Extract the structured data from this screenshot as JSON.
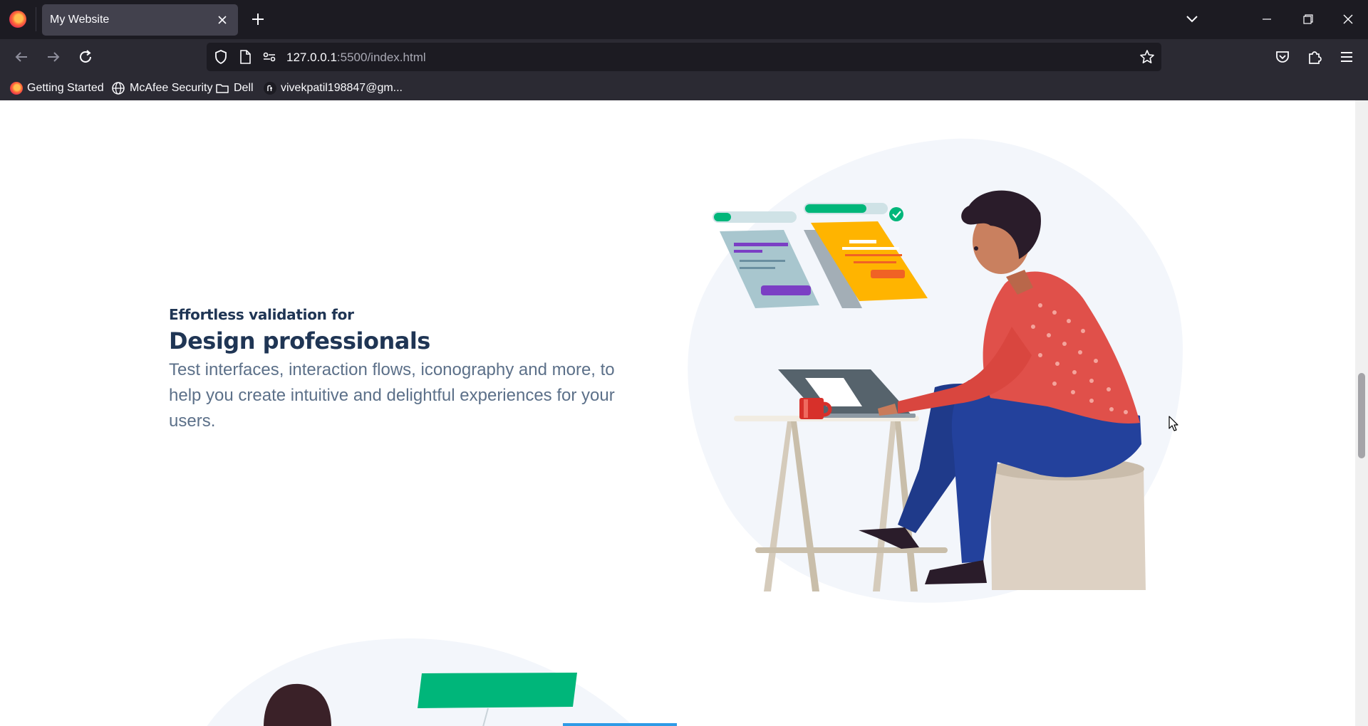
{
  "browser": {
    "tab": {
      "title": "My Website"
    },
    "url": {
      "host": "127.0.0.1",
      "rest": ":5500/index.html"
    },
    "bookmarks": [
      {
        "label": "Getting Started"
      },
      {
        "label": "McAfee Security"
      },
      {
        "label": "Dell"
      },
      {
        "label": "vivekpatil198847@gm..."
      }
    ]
  },
  "section": {
    "kicker": "Effortless validation for",
    "headline": "Design professionals",
    "description": "Test interfaces, interaction flows, iconography and more, to help you create intuitive and delightful experiences for your users."
  },
  "colors": {
    "browser_dark": "#1c1b22",
    "toolbar": "#2b2a33",
    "heading": "#1f3554",
    "body_text": "#5c7089",
    "accent_green": "#00b67a",
    "accent_yellow": "#ffb400",
    "accent_purple": "#7b3fc4",
    "shirt_red": "#e0504a",
    "jeans_blue": "#23419c"
  },
  "icons": [
    "firefox-icon",
    "close-icon",
    "plus-icon",
    "chevron-down-icon",
    "minimize-icon",
    "restore-icon",
    "back-arrow-icon",
    "forward-arrow-icon",
    "reload-icon",
    "shield-icon",
    "page-icon",
    "permissions-icon",
    "star-icon",
    "pocket-icon",
    "extensions-icon",
    "menu-icon",
    "globe-icon",
    "folder-icon"
  ]
}
